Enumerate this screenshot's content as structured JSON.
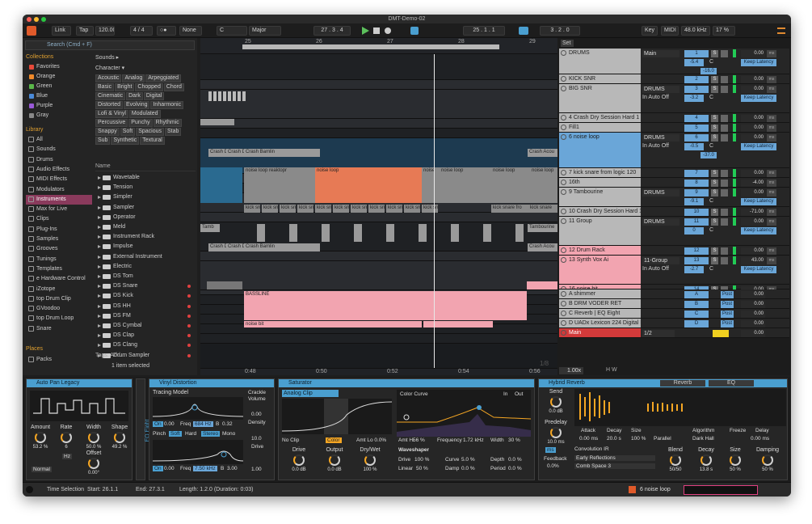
{
  "window": {
    "title": "DMT-Demo-02"
  },
  "control_bar": {
    "link": "Link",
    "tap": "Tap",
    "tempo": "120.00",
    "time_sig": "4 / 4",
    "metronome": "○●",
    "quantize": "None",
    "key": "C",
    "scale": "Major",
    "position": "27 . 3 . 4",
    "loop_start": "25 . 1 . 1",
    "loop_length": "3 . 2 . 0",
    "key_btn": "Key",
    "midi_btn": "MIDI",
    "sample_rate": "48.0 kHz",
    "cpu": "17 %"
  },
  "browser": {
    "search_placeholder": "Search (Cmd + F)",
    "collections_title": "Collections",
    "collections": [
      {
        "label": "Favorites",
        "color": "#e84a3a"
      },
      {
        "label": "Orange",
        "color": "#f08a2a"
      },
      {
        "label": "Green",
        "color": "#5ab84a"
      },
      {
        "label": "Blue",
        "color": "#4a8ad8"
      },
      {
        "label": "Purple",
        "color": "#9a5ad8"
      },
      {
        "label": "Gray",
        "color": "#888888"
      }
    ],
    "library_title": "Library",
    "library": [
      "All",
      "Sounds",
      "Drums",
      "Audio Effects",
      "MIDI Effects",
      "Modulators",
      "Instruments",
      "Max for Live",
      "Clips",
      "Plug-Ins",
      "Samples",
      "Grooves",
      "Tunings",
      "Templates",
      "e Hardware Control",
      "iZotope",
      "top Drum Clip",
      "GVoodoo",
      "top Drum Loop",
      "Snare"
    ],
    "places_title": "Places",
    "places": [
      "Packs"
    ],
    "sounds_label": "Sounds ▸",
    "character_label": "Character ▾",
    "tags_row1": [
      "Acoustic",
      "Analog",
      "Arpeggiated"
    ],
    "tags_row2": [
      "Basic",
      "Bright",
      "Chopped",
      "Chord"
    ],
    "tags_row3": [
      "Cinematic",
      "Dark",
      "Digital"
    ],
    "tags_row4": [
      "Distorted",
      "Evolving",
      "Inharmonic"
    ],
    "tags_row5": [
      "Lofi & Vinyl",
      "Modulated"
    ],
    "tags_row6": [
      "Percussive",
      "Punchy",
      "Rhythmic"
    ],
    "tags_row7": [
      "Snappy",
      "Soft",
      "Spacious",
      "Stab"
    ],
    "tags_row8": [
      "Sub",
      "Synthetic",
      "Textural"
    ],
    "name_header": "Name",
    "items": [
      {
        "label": "Wavetable",
        "red": false
      },
      {
        "label": "Tension",
        "red": false
      },
      {
        "label": "Simpler",
        "red": false
      },
      {
        "label": "Sampler",
        "red": false
      },
      {
        "label": "Operator",
        "red": false
      },
      {
        "label": "Meld",
        "red": false
      },
      {
        "label": "Instrument Rack",
        "red": false
      },
      {
        "label": "Impulse",
        "red": false
      },
      {
        "label": "External Instrument",
        "red": false
      },
      {
        "label": "Electric",
        "red": false
      },
      {
        "label": "DS Tom",
        "red": false
      },
      {
        "label": "DS Snare",
        "red": true
      },
      {
        "label": "DS Kick",
        "red": true
      },
      {
        "label": "DS HH",
        "red": true
      },
      {
        "label": "DS FM",
        "red": true
      },
      {
        "label": "DS Cymbal",
        "red": true
      },
      {
        "label": "DS Clap",
        "red": true
      },
      {
        "label": "DS Clang",
        "red": true
      },
      {
        "label": "Drum Sampler",
        "red": true
      }
    ],
    "tags_footer": "Tags:  Add...",
    "selected_info": "1 item selected"
  },
  "arrangement": {
    "ruler": [
      "25",
      "26",
      "27",
      "28",
      "29"
    ],
    "time_ruler": [
      "0:48",
      "0:50",
      "0:52",
      "0:54",
      "0:56"
    ],
    "ratio": "1/8",
    "clips": {
      "crash1": "Crash D",
      "crash2": "Crash D",
      "crash3": "Crash Bamlin",
      "crash_acou": "Crash Acou",
      "noise_top": "noise loop reaktopr",
      "noise2": "noise loop",
      "noise3": "noise",
      "noise4": "noise loop",
      "noise5": "noise loop",
      "noise6": "noise loop",
      "kick": "kick sn",
      "kick_long": "kick snare fro",
      "kick_long2": "kick snare",
      "tamb": "Tamb",
      "tamb_long": "Tambourine",
      "bassline": "BASSLINE",
      "noise_bit": "noise bit"
    }
  },
  "mixer": {
    "set_label": "Set",
    "tracks": [
      {
        "name": "DRUMS",
        "num": "1",
        "color": "#b8b8b8",
        "h": 32,
        "route": "Main",
        "vol": "0.00",
        "extra": "Keep Latency",
        "pan": "-5.4",
        "c": "C",
        "db": "-16.0"
      },
      {
        "name": "KICK SNR",
        "num": "2",
        "color": "#b8b8b8",
        "h": 12,
        "vol": "0.00"
      },
      {
        "name": "BIG SNR",
        "num": "3",
        "color": "#b8b8b8",
        "h": 36,
        "route": "DRUMS",
        "vol": "0.00",
        "extra": "Keep Latency",
        "pan": "-3.2",
        "c": "C",
        "io": "In  Auto  Off"
      },
      {
        "name": "4 Crash Dry Session Hard 1",
        "num": "4",
        "color": "#b8b8b8",
        "h": 12,
        "vol": "0.00"
      },
      {
        "name": "Fill1",
        "num": "5",
        "color": "#b8b8b8",
        "h": 12,
        "vol": "0.00"
      },
      {
        "name": "6 noise loop",
        "num": "6",
        "color": "#6aa6d8",
        "h": 44,
        "route": "DRUMS",
        "vol": "0.00",
        "extra": "Keep Latency",
        "pan": "-0.5",
        "c": "C",
        "db": "-37.0",
        "io": "In  Auto  Off"
      },
      {
        "name": "7 kick snare from logic 120",
        "num": "7",
        "color": "#b8b8b8",
        "h": 12,
        "vol": "0.00"
      },
      {
        "name": "16th",
        "num": "8",
        "color": "#b8b8b8",
        "h": 12,
        "vol": "-4.00"
      },
      {
        "name": "9 Tambourine",
        "num": "9",
        "color": "#b8b8b8",
        "h": 24,
        "route": "DRUMS",
        "vol": "0.00",
        "extra": "Keep Latency",
        "pan": "-9.1",
        "c": "C"
      },
      {
        "name": "10 Crash Dry Session Hard 1",
        "num": "10",
        "color": "#b8b8b8",
        "h": 12,
        "vol": "-71.00"
      },
      {
        "name": "11 Group",
        "num": "11",
        "color": "#b8b8b8",
        "h": 36,
        "route": "DRUMS",
        "vol": "0.00",
        "extra": "Keep Latency",
        "pan": "0",
        "c": "C"
      },
      {
        "name": "12 Drum Rack",
        "num": "12",
        "color": "#f2a4b0",
        "h": 12,
        "vol": "0.00"
      },
      {
        "name": "13 Synth Vox Ai",
        "num": "13",
        "color": "#f2a4b0",
        "h": 36,
        "route": "11-Group",
        "vol": "43.00",
        "extra": "Keep Latency",
        "pan": "-2.7",
        "c": "C",
        "io": "In  Auto  Off"
      },
      {
        "name": "16 noise bit",
        "num": "14",
        "color": "#f2a4b0",
        "h": 6,
        "vol": "0.00"
      }
    ],
    "returns": [
      {
        "name": "A shimmer",
        "letter": "A",
        "post": "Post",
        "vol": "0.00"
      },
      {
        "name": "B DRM VODER RET",
        "letter": "B",
        "post": "Post",
        "vol": "0.00"
      },
      {
        "name": "C Reverb | EQ Eight",
        "letter": "C",
        "post": "Post",
        "vol": "0.00"
      },
      {
        "name": "D UADx Lexicon 224 Digital R",
        "letter": "D",
        "post": "Post",
        "vol": "0.00"
      }
    ],
    "main": {
      "name": "Main",
      "route": "1/2",
      "vol": "0.00"
    },
    "zoom": "1.00x",
    "hw": "H  W"
  },
  "devices": {
    "autopan": {
      "title": "Auto Pan Legacy",
      "amount_l": "Amount",
      "amount": "53.2 %",
      "rate_l": "Rate",
      "rate": "6",
      "width_l": "Width",
      "width": "50.0 %",
      "shape_l": "Shape",
      "shape": "49.2 %",
      "hz": "Hz",
      "offset_l": "Offset",
      "offset": "0.00°",
      "normal": "Normal"
    },
    "eq_tab": "EQ Eight",
    "vinyl": {
      "title": "Vinyl Distortion",
      "tracing": "Tracing Model",
      "crackle_l": "Crackle",
      "volume_l": "Volume",
      "volume": "0.00",
      "density_l": "Density",
      "density": "10.0",
      "drive_l": "Drive",
      "drive": "1.00",
      "on1": "On",
      "v1": "0.00",
      "freq_l": "Freq",
      "freq1": "684 Hz",
      "b": "B",
      "bv": "0.32",
      "pinch": "Pinch",
      "soft": "Soft",
      "hard": "Hard",
      "stereo": "Stereo",
      "mono": "Mono",
      "on2": "On",
      "v2": "0.00",
      "freq2": "7.50 kHz",
      "bv2": "3.00"
    },
    "saturator": {
      "title": "Saturator",
      "mode": "Analog Clip",
      "noclip": "No Clip",
      "color": "Color",
      "amtlo": "Amt Lo 0.0%",
      "drive_l": "Drive",
      "drive": "0.0 dB",
      "output_l": "Output",
      "output": "0.0 dB",
      "drywet_l": "Dry/Wet",
      "drywet": "100 %",
      "curve_title": "Color Curve",
      "in": "In",
      "out": "Out",
      "amthi": "Amt Hi",
      "amthi_v": "56 %",
      "freq_l": "Frequency",
      "freq": "1.72 kHz",
      "width_l": "Width",
      "width": "30 %",
      "waveshaper": "Waveshaper",
      "ws_drive_l": "Drive",
      "ws_drive": "100 %",
      "ws_curve_l": "Curve",
      "ws_curve": "5.0 %",
      "ws_depth_l": "Depth",
      "ws_depth": "0.0 %",
      "ws_lin_l": "Linear",
      "ws_lin": "50 %",
      "ws_damp_l": "Damp",
      "ws_damp": "0.0 %",
      "ws_period_l": "Period",
      "ws_period": "0.0 %"
    },
    "reverb": {
      "title": "Hybrid Reverb",
      "tab_reverb": "Reverb",
      "tab_eq": "EQ",
      "send_l": "Send",
      "send": "0.0 dB",
      "predelay_l": "Predelay",
      "predelay": "10.0 ms",
      "ms": "ms",
      "feedback_l": "Feedback",
      "feedback": "0.0%",
      "attack_l": "Attack",
      "attack": "0.00 ms",
      "decay_l": "Decay",
      "decay": "20.0 s",
      "size_l": "Size",
      "size": "100 %",
      "parallel": "Parallel",
      "algo_l": "Algorithm",
      "algo": "Dark Hall",
      "freeze_l": "Freeze",
      "delay_l": "Delay",
      "delay": "0.00 ms",
      "conv": "Convolution IR",
      "ir1": "Early Reflections",
      "ir2": "Comb Space 3",
      "blend_l": "Blend",
      "blend": "50/50",
      "decay2_l": "Decay",
      "decay2": "13.8 s",
      "size2_l": "Size",
      "size2": "50 %",
      "damp_l": "Damping",
      "damp": "50 %"
    }
  },
  "status": {
    "mode": "Time Selection",
    "start": "Start: 26.1.1",
    "end": "End: 27.3.1",
    "length": "Length: 1.2.0  (Duration: 0:03)",
    "track": "6 noise loop"
  }
}
